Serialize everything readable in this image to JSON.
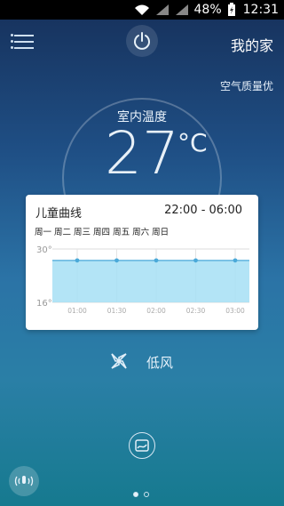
{
  "status_bar": {
    "battery_percent": "48%",
    "time": "12:31"
  },
  "header": {
    "home_title": "我的家"
  },
  "air_quality": "空气质量优",
  "indoor": {
    "label": "室内温度",
    "temperature": "27",
    "unit": "°C"
  },
  "schedule_card": {
    "title": "儿童曲线",
    "time_range": "22:00 - 06:00",
    "days": "周一 周二 周三 周四 周五 周六 周日"
  },
  "chart_data": {
    "type": "area",
    "x": [
      "01:00",
      "01:30",
      "02:00",
      "02:30",
      "03:00"
    ],
    "series": [
      {
        "values": [
          27,
          27,
          27,
          27,
          27
        ]
      }
    ],
    "ylim": [
      16,
      30
    ],
    "y_tick_labels": [
      "30°",
      "16°"
    ],
    "grid": true,
    "fill_color": "#a6dff4",
    "line_color": "#4aa9d9"
  },
  "fan": {
    "label": "低风"
  },
  "colors": {
    "accent": "#4aa9d9"
  }
}
